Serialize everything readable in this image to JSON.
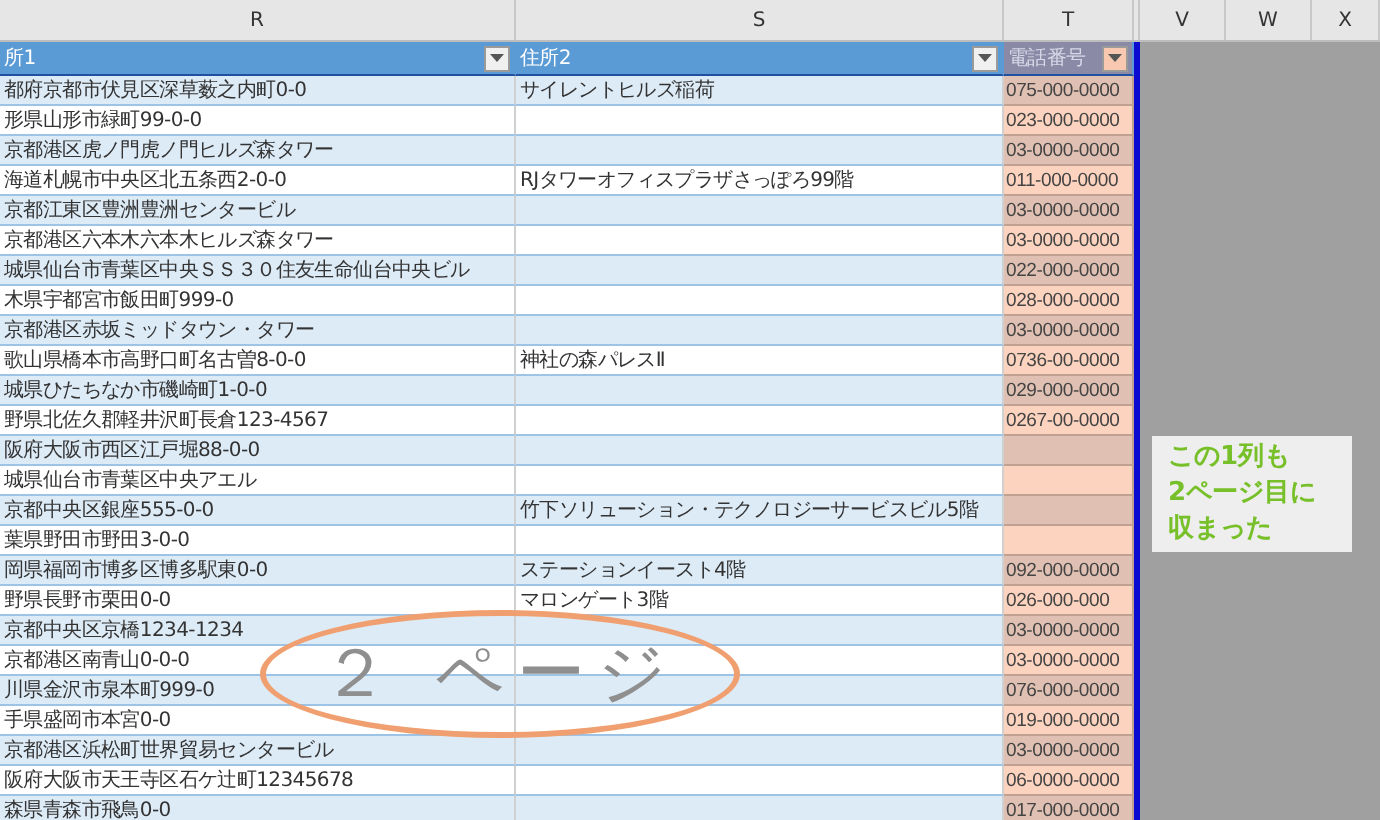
{
  "column_headers": [
    "R",
    "S",
    "T",
    "V",
    "W",
    "X"
  ],
  "table": {
    "columns": [
      "所1",
      "住所2",
      "電話番号"
    ],
    "rows": [
      {
        "address_1": "都府京都市伏見区深草薮之内町0-0",
        "address_2": "サイレントヒルズ稲荷",
        "phone": "075-000-0000"
      },
      {
        "address_1": "形県山形市緑町99-0-0",
        "phone": "023-000-0000"
      },
      {
        "address_1": "京都港区虎ノ門虎ノ門ヒルズ森タワー",
        "phone": "03-0000-0000"
      },
      {
        "address_1": "海道札幌市中央区北五条西2-0-0",
        "address_2": "RJタワーオフィスプラザさっぽろ99階",
        "phone": "011-000-0000"
      },
      {
        "address_1": "京都江東区豊洲豊洲センタービル",
        "phone": "03-0000-0000"
      },
      {
        "address_1": "京都港区六本木六本木ヒルズ森タワー",
        "phone": "03-0000-0000"
      },
      {
        "address_1": "城県仙台市青葉区中央ＳＳ３０住友生命仙台中央ビル",
        "phone": "022-000-0000"
      },
      {
        "address_1": "木県宇都宮市飯田町999-0",
        "phone": "028-000-0000"
      },
      {
        "address_1": "京都港区赤坂ミッドタウン・タワー",
        "phone": "03-0000-0000"
      },
      {
        "address_1": "歌山県橋本市高野口町名古曽8-0-0",
        "address_2": "神社の森パレスⅡ",
        "phone": "0736-00-0000"
      },
      {
        "address_1": "城県ひたちなか市磯崎町1-0-0",
        "phone": "029-000-0000"
      },
      {
        "address_1": "野県北佐久郡軽井沢町長倉123-4567",
        "phone": "0267-00-0000"
      },
      {
        "address_1": "阪府大阪市西区江戸堀88-0-0"
      },
      {
        "address_1": "城県仙台市青葉区中央アエル"
      },
      {
        "address_1": "京都中央区銀座555-0-0",
        "address_2": "竹下ソリューション・テクノロジーサービスビル5階"
      },
      {
        "address_1": "葉県野田市野田3-0-0"
      },
      {
        "address_1": "岡県福岡市博多区博多駅東0-0",
        "address_2": "ステーションイースト4階",
        "phone": "092-000-0000"
      },
      {
        "address_1": "野県長野市栗田0-0",
        "address_2": "マロンゲート3階",
        "phone": "026-000-000"
      },
      {
        "address_1": "京都中央区京橋1234-1234",
        "phone": "03-0000-0000"
      },
      {
        "address_1": "京都港区南青山0-0-0",
        "phone": "03-0000-0000"
      },
      {
        "address_1": "川県金沢市泉本町999-0",
        "phone": "076-000-0000"
      },
      {
        "address_1": "手県盛岡市本宮0-0",
        "phone": "019-000-0000"
      },
      {
        "address_1": "京都港区浜松町世界貿易センタービル",
        "phone": "03-0000-0000"
      },
      {
        "address_1": "阪府大阪市天王寺区石ケ辻町12345678",
        "phone": "06-0000-0000"
      },
      {
        "address_1": "森県青森市飛鳥0-0",
        "phone": "017-000-0000"
      }
    ]
  },
  "annotations": {
    "ellipse_label": "２ ページ",
    "callout": [
      "この1列も",
      "2ページ目に",
      "収まった"
    ]
  }
}
